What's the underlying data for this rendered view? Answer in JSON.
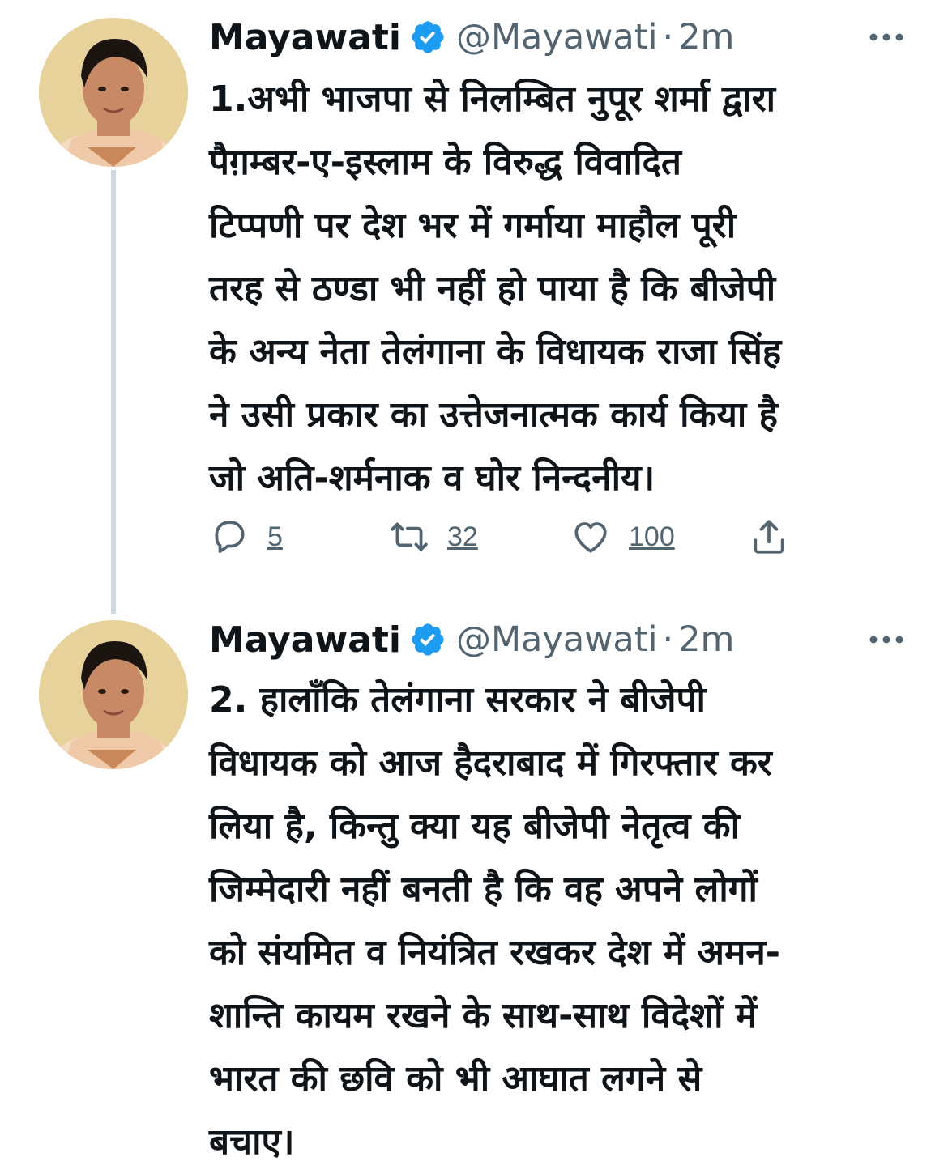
{
  "tweets": [
    {
      "author": {
        "display_name": "Mayawati",
        "handle": "@Mayawati",
        "verified": true,
        "avatar_icon": "profile-photo"
      },
      "separator": "·",
      "time": "2m",
      "text": "1.अभी भाजपा से निलम्बित नुपूर शर्मा द्वारा\nपैग़म्बर-ए-इस्लाम के विरुद्ध विवादित\nटिप्पणी पर देश भर में गर्माया माहौल पूरी\nतरह से ठण्डा भी नहीं हो पाया है कि बीजेपी\nके अन्य नेता तेलंगाना के विधायक राजा सिंह\nने उसी प्रकार का उत्तेजनात्मक कार्य किया है\nजो अति-शर्मनाक व घोर निन्दनीय।",
      "stats": {
        "replies": "5",
        "retweets": "32",
        "likes": "100"
      }
    },
    {
      "author": {
        "display_name": "Mayawati",
        "handle": "@Mayawati",
        "verified": true,
        "avatar_icon": "profile-photo"
      },
      "separator": "·",
      "time": "2m",
      "text": "2. हालाँकि तेलंगाना सरकार ने बीजेपी\nविधायक को आज हैदराबाद में गिरफ्तार कर\nलिया है, किन्तु क्या यह बीजेपी नेतृत्व की\nजिम्मेदारी नहीं बनती है कि वह अपने लोगों\nको संयमित व नियंत्रित रखकर देश में अमन-\nशान्ति कायम रखने के साथ-साथ विदेशों में\nभारत की छवि को भी आघात लगने से\nबचाए।"
    }
  ],
  "icons": {
    "verified": "verified-badge-icon",
    "more": "more-options-icon",
    "reply": "reply-icon",
    "retweet": "retweet-icon",
    "like": "heart-icon",
    "share": "share-icon"
  },
  "colors": {
    "text_primary": "#0f1419",
    "text_secondary": "#536471",
    "verified_blue": "#1d9bf0",
    "thread_line": "#cfd9de",
    "avatar_background": "#e8d29b"
  }
}
